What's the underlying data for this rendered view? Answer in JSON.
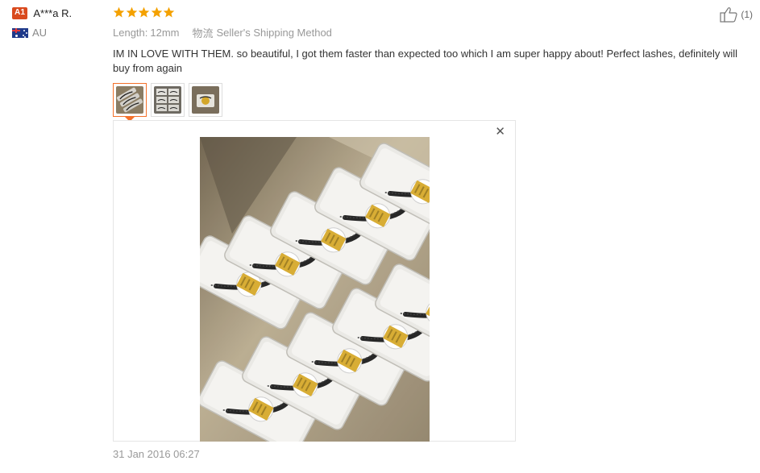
{
  "user": {
    "level_badge": "A1",
    "name": "A***a R.",
    "country": "AU",
    "flag_icon": "australia-flag-icon"
  },
  "review": {
    "rating": 5,
    "rating_max": 5,
    "star_color": "#f4a100",
    "length_label": "Length:",
    "length_value": "12mm",
    "shipping_label": "物流",
    "shipping_value": "Seller's Shipping Method",
    "text": "IM IN LOVE WITH THEM. so beautiful, I got them faster than expected too which I am super happy about! Perfect lashes, definitely will buy from again",
    "timestamp": "31 Jan 2016 06:27"
  },
  "thumbnails": [
    {
      "name": "review-photo-1",
      "active": true
    },
    {
      "name": "review-photo-2",
      "active": false
    },
    {
      "name": "review-photo-3",
      "active": false
    }
  ],
  "viewer": {
    "close_label": "✕"
  },
  "helpful": {
    "icon": "thumbs-up-icon",
    "count_label": "(1)"
  },
  "colors": {
    "accent": "#f4712a",
    "badge": "#d94a1e"
  }
}
